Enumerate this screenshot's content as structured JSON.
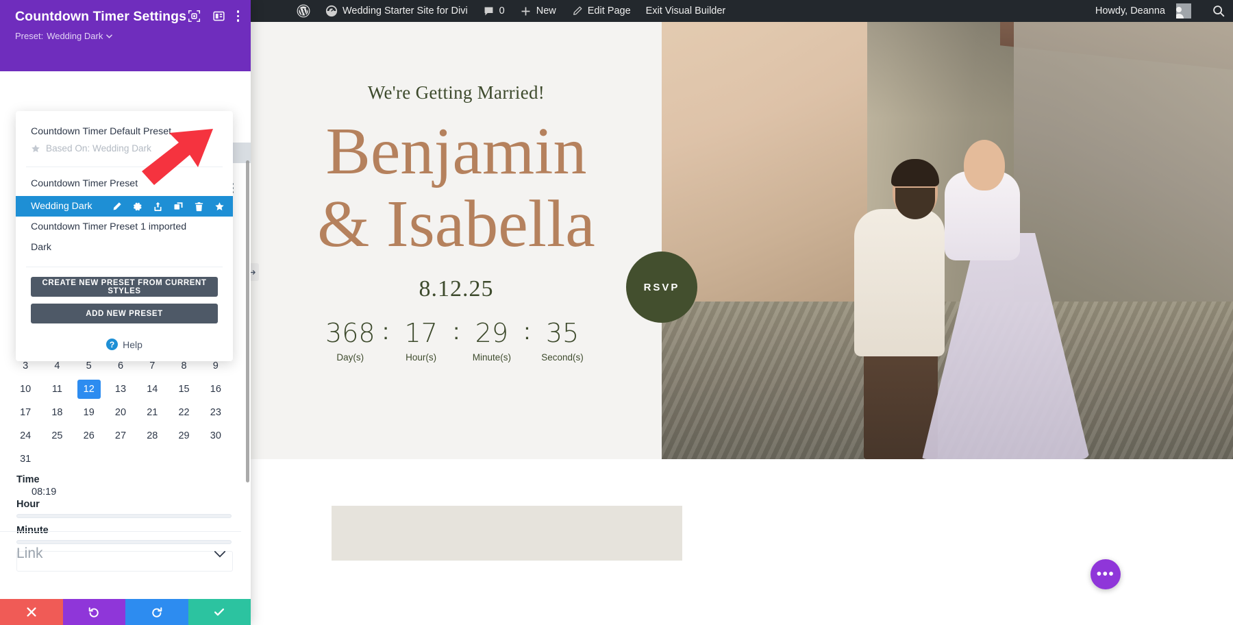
{
  "adminbar": {
    "wp_logo": "wordpress-logo-icon",
    "site_name": "Wedding Starter Site for Divi",
    "comments_count": "0",
    "new_label": "New",
    "edit_page_label": "Edit Page",
    "exit_builder_label": "Exit Visual Builder",
    "howdy": "Howdy, Deanna",
    "search_icon": "search-icon"
  },
  "modal": {
    "title": "Countdown Timer Settings",
    "preset_prefix": "Preset:",
    "preset_name": "Wedding Dark",
    "header_icons": [
      "focus-frame-icon",
      "layout-panel-icon",
      "kebab-menu-icon"
    ],
    "link_section_label": "Link",
    "actions": {
      "cancel": "cancel-icon",
      "undo": "undo-icon",
      "redo": "redo-icon",
      "save": "save-check-icon"
    }
  },
  "preset_popup": {
    "default_preset_label": "Countdown Timer Default Preset",
    "based_on_label": "Based On: Wedding Dark",
    "group_label": "Countdown Timer Preset",
    "items": [
      {
        "label": "Wedding Dark",
        "active": true
      },
      {
        "label": "Countdown Timer Preset 1 imported",
        "active": false
      },
      {
        "label": "Dark",
        "active": false
      }
    ],
    "active_item_icons": [
      "pencil-icon",
      "gear-icon",
      "export-icon",
      "duplicate-icon",
      "trash-icon",
      "star-icon"
    ],
    "create_button": "CREATE NEW PRESET FROM CURRENT STYLES",
    "add_button": "ADD NEW PRESET",
    "help_label": "Help",
    "help_icon": "help-question-icon"
  },
  "date_panel": {
    "days": [
      "3",
      "4",
      "5",
      "6",
      "7",
      "8",
      "9",
      "10",
      "11",
      "12",
      "13",
      "14",
      "15",
      "16",
      "17",
      "18",
      "19",
      "20",
      "21",
      "22",
      "23",
      "24",
      "25",
      "26",
      "27",
      "28",
      "29",
      "30",
      "31"
    ],
    "selected_day": "12",
    "time_label": "Time",
    "time_value": "08:19",
    "hour_label": "Hour",
    "minute_label": "Minute"
  },
  "site": {
    "kicker": "We're Getting Married!",
    "name_line1": "Benjamin",
    "name_line2": "& Isabella",
    "date": "8.12.25",
    "rsvp_label": "RSVP",
    "fab_icon": "more-options-icon"
  },
  "countdown": {
    "units": [
      {
        "value": "368",
        "label": "Day(s)"
      },
      {
        "value": "17",
        "label": "Hour(s)"
      },
      {
        "value": "29",
        "label": "Minute(s)"
      },
      {
        "value": "35",
        "label": "Second(s)"
      }
    ],
    "separator": ":"
  },
  "colors": {
    "divi_purple": "#6f2dbd",
    "active_blue": "#1e8fd5",
    "button_slate": "#4e5967",
    "accent_rose": "#b5815d",
    "olive": "#434f2e",
    "adminbar": "#23282d",
    "cancel_red": "#f05b56",
    "save_green": "#2cc3a0",
    "arrow_red": "#f5333f"
  }
}
